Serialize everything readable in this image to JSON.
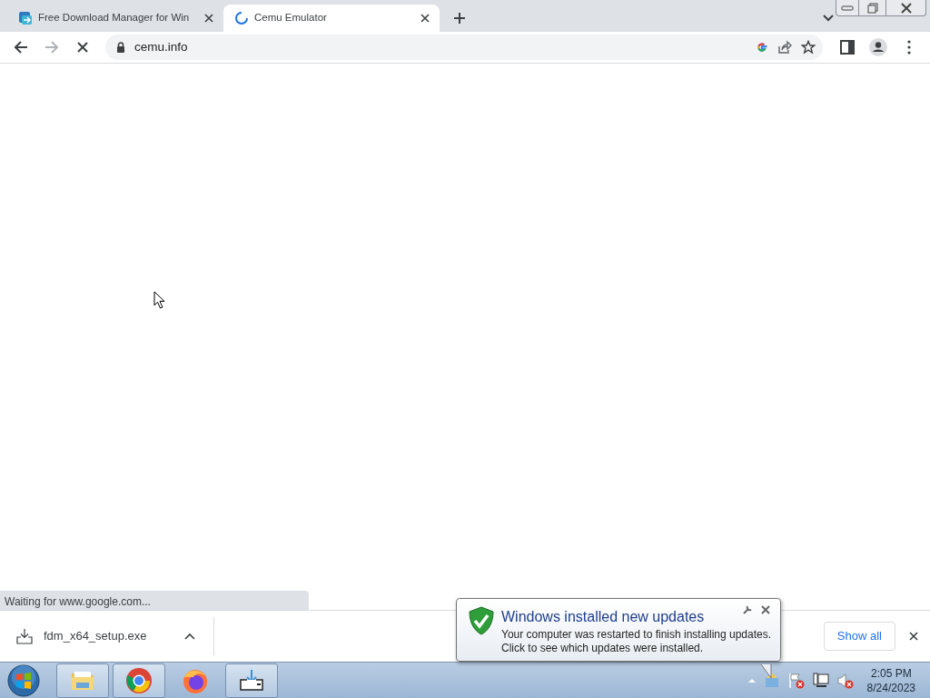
{
  "tabs": [
    {
      "title": "Free Download Manager for Win",
      "selected": false,
      "loading": false
    },
    {
      "title": "Cemu Emulator",
      "selected": true,
      "loading": true
    }
  ],
  "toolbar": {
    "url": "cemu.info",
    "page_loading": true
  },
  "status_bubble": "Waiting for www.google.com...",
  "downloads": [
    {
      "filename": "fdm_x64_setup.exe"
    }
  ],
  "show_all_button": "Show all",
  "notification": {
    "title": "Windows installed new updates",
    "lines": [
      "Your computer was restarted to finish installing updates.",
      "Click to see which updates were installed."
    ]
  },
  "taskbar": {
    "apps": [
      {
        "kind": "explorer"
      },
      {
        "kind": "chrome"
      },
      {
        "kind": "firefox"
      },
      {
        "kind": "downloader"
      }
    ],
    "clock": {
      "time": "2:05 PM",
      "date": "8/24/2023"
    }
  }
}
